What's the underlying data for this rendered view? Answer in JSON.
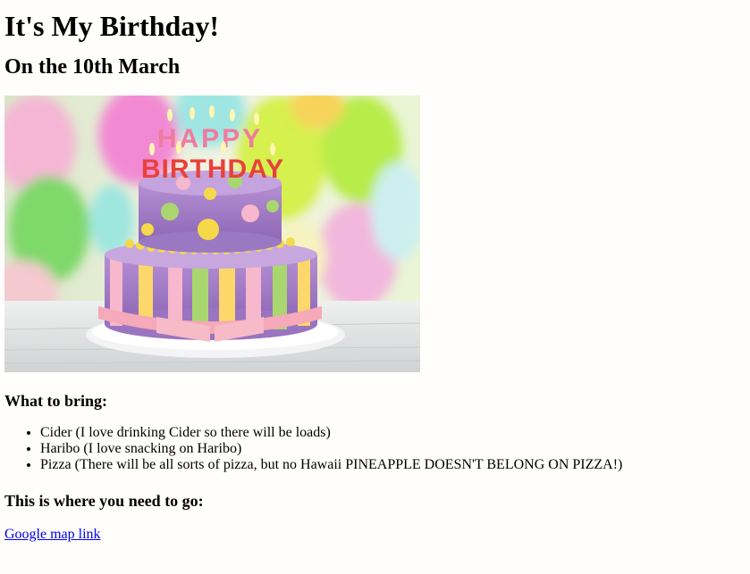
{
  "heading": "It's My Birthday!",
  "subheading": "On the 10th March",
  "image": {
    "candle_top": "HAPPY",
    "candle_bottom": "BIRTHDAY"
  },
  "bring": {
    "title": "What to bring:",
    "items": [
      "Cider (I love drinking Cider so there will be loads)",
      "Haribo (I love snacking on Haribo)",
      "Pizza (There will be all sorts of pizza, but no Hawaii PINEAPPLE DOESN'T BELONG ON PIZZA!)"
    ]
  },
  "location": {
    "title": "This is where you need to go:",
    "link_text": "Google map link"
  },
  "colors": {
    "link": "#0000ee",
    "background": "#fffefc"
  }
}
